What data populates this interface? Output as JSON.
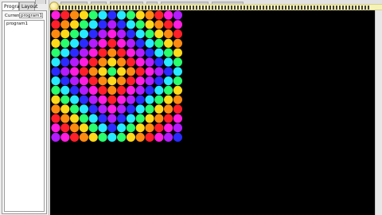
{
  "side_panel": {
    "tabs": [
      {
        "label": "Program",
        "active": true
      },
      {
        "label": "Layout",
        "active": false
      },
      {
        "label": "",
        "active": false
      }
    ],
    "current_label": "Current",
    "current_value": "program1",
    "tree_items": [
      "program1"
    ]
  },
  "stage": {
    "background": "#000000",
    "grid_rows": 14,
    "grid_cols": 14,
    "colors": {
      "magenta": "#ff1de0",
      "violet": "#b21cff",
      "blue": "#2a2bff",
      "cyan": "#27e9ff",
      "green": "#29ff6d",
      "yellow": "#ffd91a",
      "orange": "#ff8a12",
      "red": "#ff1f2a"
    }
  }
}
